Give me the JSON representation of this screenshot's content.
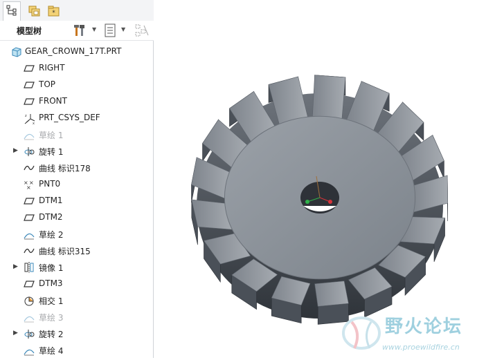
{
  "panel": {
    "tabs": [
      {
        "name": "model-tree-tab-icon",
        "active": true
      },
      {
        "name": "folder-browser-tab-icon",
        "active": false
      },
      {
        "name": "favorites-tab-icon",
        "active": false
      }
    ],
    "title": "模型树",
    "tools": [
      "settings-icon",
      "show-options-icon",
      "filter-icon"
    ]
  },
  "tree": {
    "items": [
      {
        "label": "GEAR_CROWN_17T.PRT",
        "icon": "part-icon",
        "expandable": false,
        "dim": false
      },
      {
        "label": "RIGHT",
        "icon": "datum-plane-icon",
        "expandable": false,
        "dim": false
      },
      {
        "label": "TOP",
        "icon": "datum-plane-icon",
        "expandable": false,
        "dim": false
      },
      {
        "label": "FRONT",
        "icon": "datum-plane-icon",
        "expandable": false,
        "dim": false
      },
      {
        "label": "PRT_CSYS_DEF",
        "icon": "csys-icon",
        "expandable": false,
        "dim": false
      },
      {
        "label": "草绘 1",
        "icon": "sketch-icon",
        "expandable": false,
        "dim": true
      },
      {
        "label": "旋转 1",
        "icon": "revolve-icon",
        "expandable": true,
        "dim": false
      },
      {
        "label": "曲线 标识178",
        "icon": "curve-icon",
        "expandable": false,
        "dim": false
      },
      {
        "label": "PNT0",
        "icon": "datum-point-icon",
        "expandable": false,
        "dim": false
      },
      {
        "label": "DTM1",
        "icon": "datum-plane-icon",
        "expandable": false,
        "dim": false
      },
      {
        "label": "DTM2",
        "icon": "datum-plane-icon",
        "expandable": false,
        "dim": false
      },
      {
        "label": "草绘 2",
        "icon": "sketch-icon",
        "expandable": false,
        "dim": false
      },
      {
        "label": "曲线 标识315",
        "icon": "curve-icon",
        "expandable": false,
        "dim": false
      },
      {
        "label": "镜像 1",
        "icon": "mirror-icon",
        "expandable": true,
        "dim": false
      },
      {
        "label": "DTM3",
        "icon": "datum-plane-icon",
        "expandable": false,
        "dim": false
      },
      {
        "label": "相交 1",
        "icon": "intersect-icon",
        "expandable": false,
        "dim": false
      },
      {
        "label": "草绘 3",
        "icon": "sketch-icon",
        "expandable": false,
        "dim": true
      },
      {
        "label": "旋转 2",
        "icon": "revolve-icon",
        "expandable": true,
        "dim": false
      },
      {
        "label": "草绘 4",
        "icon": "sketch-icon",
        "expandable": false,
        "dim": false
      }
    ]
  },
  "viewport": {
    "model": "gear-model",
    "teeth": 17
  },
  "watermark": {
    "title": "野火论坛",
    "url": "www.proewildfire.cn"
  },
  "colors": {
    "gear_face": "#8b9199",
    "gear_dark": "#3f444b",
    "accent_red": "#d6333a",
    "accent_green": "#2fb34a",
    "watermark": "#9fd0df"
  }
}
